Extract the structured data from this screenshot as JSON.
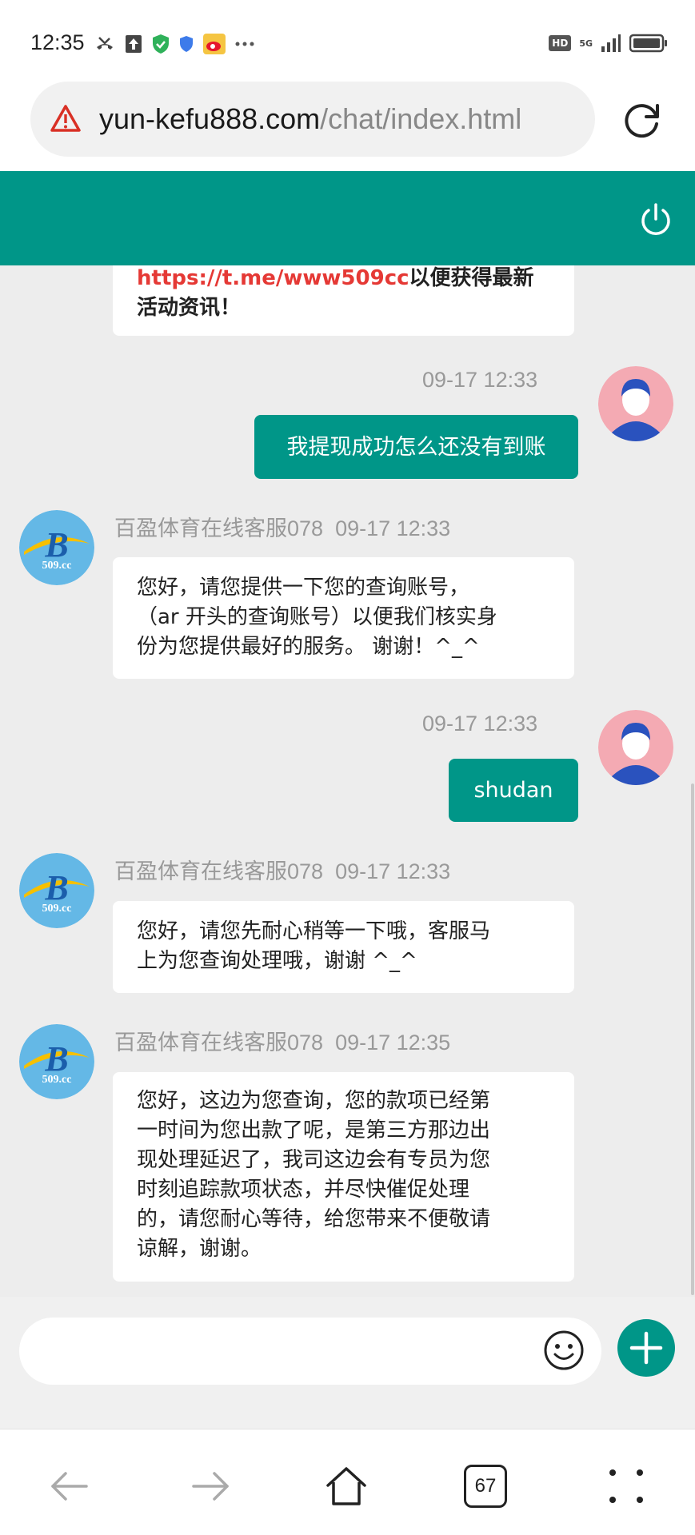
{
  "status_bar": {
    "time": "12:35",
    "icons": [
      "missed-call-icon",
      "upload-icon",
      "shield-check-icon",
      "shield-icon",
      "weibo-icon",
      "more-icon"
    ],
    "network": "5G",
    "hd": "HD"
  },
  "browser": {
    "url_host": "yun-kefu888.com",
    "url_path": "/chat/index.html",
    "tab_count": "67"
  },
  "chat": {
    "partial_message": {
      "link": "https://t.me/www509cc",
      "line1_rest": "以便获得最新",
      "line2": "活动资讯！"
    },
    "messages": [
      {
        "from": "me",
        "time": "09-17 12:33",
        "text": "我提现成功怎么还没有到账"
      },
      {
        "from": "agent",
        "sender": "百盈体育在线客服078",
        "time": "09-17 12:33",
        "lines": [
          "您好，请您提供一下您的查询账号，",
          "（ar 开头的查询账号）以便我们核实身",
          "份为您提供最好的服务。 谢谢！^_^"
        ]
      },
      {
        "from": "me",
        "time": "09-17 12:33",
        "text": "shudan"
      },
      {
        "from": "agent",
        "sender": "百盈体育在线客服078",
        "time": "09-17 12:33",
        "lines": [
          "您好，请您先耐心稍等一下哦，客服马",
          "上为您查询处理哦，谢谢 ^_^"
        ]
      },
      {
        "from": "agent",
        "sender": "百盈体育在线客服078",
        "time": "09-17 12:35",
        "lines": [
          "您好，这边为您查询，您的款项已经第",
          "一时间为您出款了呢，是第三方那边出",
          "现处理延迟了，我司这边会有专员为您",
          "时刻追踪款项状态，并尽快催促处理",
          "的，请您耐心等待，给您带来不便敬请",
          "谅解，谢谢。"
        ]
      }
    ],
    "agent_logo_text": "509.cc"
  },
  "colors": {
    "accent": "#009688",
    "link": "#e53935"
  }
}
